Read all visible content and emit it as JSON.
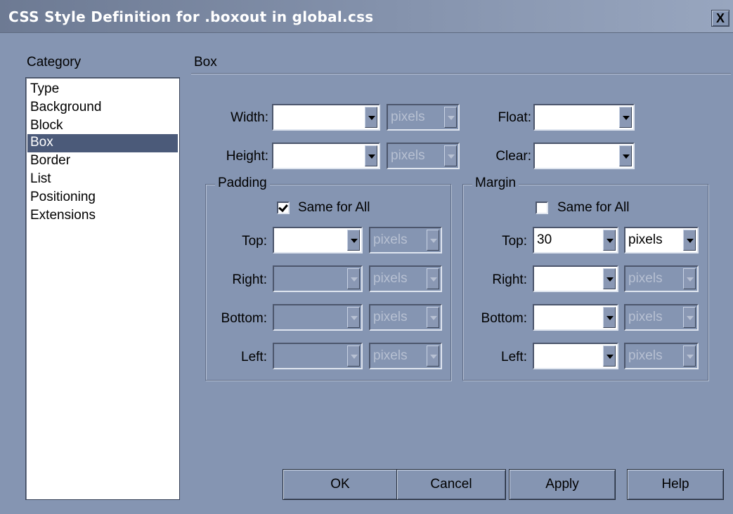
{
  "window": {
    "title": "CSS Style Definition for .boxout in global.css",
    "close_label": "X"
  },
  "category": {
    "header": "Category",
    "items": [
      "Type",
      "Background",
      "Block",
      "Box",
      "Border",
      "List",
      "Positioning",
      "Extensions"
    ],
    "selected": "Box"
  },
  "section_title": "Box",
  "fields": {
    "width": {
      "label": "Width:",
      "value": "",
      "unit": "pixels"
    },
    "height": {
      "label": "Height:",
      "value": "",
      "unit": "pixels"
    },
    "float": {
      "label": "Float:",
      "value": ""
    },
    "clear": {
      "label": "Clear:",
      "value": ""
    }
  },
  "padding": {
    "title": "Padding",
    "same_for_all_label": "Same for All",
    "same_for_all": true,
    "top": {
      "label": "Top:",
      "value": "",
      "unit": "pixels"
    },
    "right": {
      "label": "Right:",
      "value": "",
      "unit": "pixels"
    },
    "bottom": {
      "label": "Bottom:",
      "value": "",
      "unit": "pixels"
    },
    "left": {
      "label": "Left:",
      "value": "",
      "unit": "pixels"
    }
  },
  "margin": {
    "title": "Margin",
    "same_for_all_label": "Same for All",
    "same_for_all": false,
    "top": {
      "label": "Top:",
      "value": "30",
      "unit": "pixels"
    },
    "right": {
      "label": "Right:",
      "value": "",
      "unit": "pixels"
    },
    "bottom": {
      "label": "Bottom:",
      "value": "",
      "unit": "pixels"
    },
    "left": {
      "label": "Left:",
      "value": "",
      "unit": "pixels"
    }
  },
  "buttons": {
    "ok": "OK",
    "cancel": "Cancel",
    "apply": "Apply",
    "help": "Help"
  },
  "colors": {
    "dialog_bg": "#8595b2",
    "selection_bg": "#4b5a79"
  }
}
